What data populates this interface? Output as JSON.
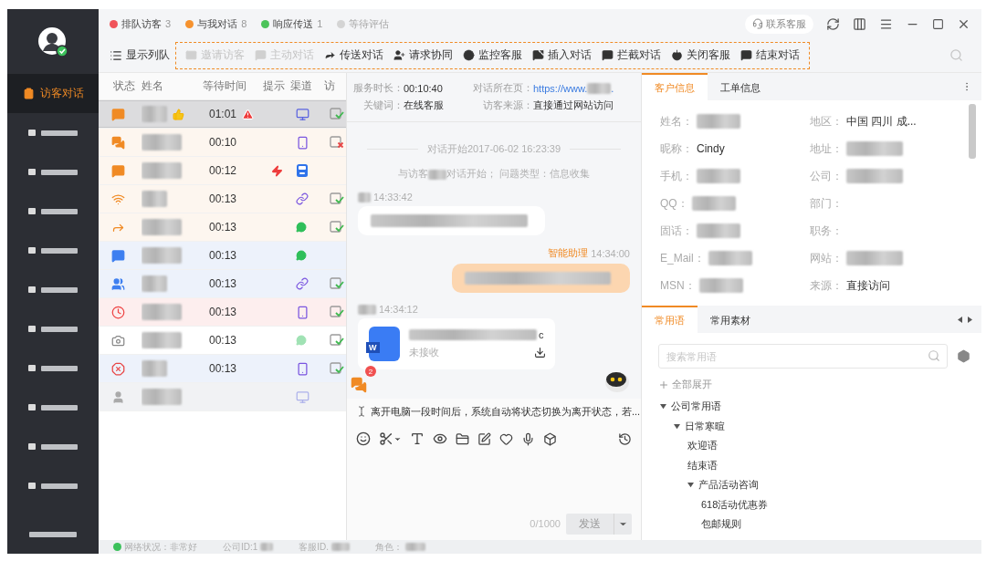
{
  "sidebar": {
    "items": [
      {
        "kind": "nav",
        "label": "访客对话",
        "selected": true
      },
      {
        "kind": "nav",
        "redacted": true,
        "selected": false
      },
      {
        "kind": "nav",
        "redacted": true,
        "selected": false
      },
      {
        "kind": "nav",
        "redacted": true,
        "selected": false
      },
      {
        "kind": "nav",
        "redacted": true,
        "selected": false
      },
      {
        "kind": "nav",
        "redacted": true,
        "selected": false
      },
      {
        "kind": "nav",
        "redacted": true,
        "selected": false
      },
      {
        "kind": "nav",
        "redacted": true,
        "selected": false
      },
      {
        "kind": "nav",
        "redacted": true,
        "selected": false
      },
      {
        "kind": "nav",
        "redacted": true,
        "selected": false
      },
      {
        "kind": "nav",
        "redacted": true,
        "selected": false
      },
      {
        "kind": "footer",
        "redacted": true,
        "selected": false
      }
    ]
  },
  "queue_tabs": [
    {
      "label": "排队访客",
      "count": "3",
      "color": "#f0535a",
      "disabled": false
    },
    {
      "label": "与我对话",
      "count": "8",
      "color": "#f6922e",
      "disabled": false
    },
    {
      "label": "响应传送",
      "count": "1",
      "color": "#4cc35a",
      "disabled": false
    },
    {
      "label": "等待评估",
      "color": "#d4d4d4",
      "disabled": true
    }
  ],
  "contact_button": "联系客服",
  "toolbar": {
    "queue_toggle": "显示列队",
    "actions": [
      {
        "label": "邀请访客",
        "disabled": true
      },
      {
        "label": "主动对话",
        "disabled": true
      },
      {
        "label": "传送对话",
        "disabled": false
      },
      {
        "label": "请求协同",
        "disabled": false
      },
      {
        "label": "监控客服",
        "disabled": false
      },
      {
        "label": "插入对话",
        "disabled": false
      },
      {
        "label": "拦截对话",
        "disabled": false
      },
      {
        "label": "关闭客服",
        "disabled": false
      },
      {
        "label": "结束对话",
        "disabled": false
      }
    ]
  },
  "visitor_table": {
    "columns": [
      "状态",
      "姓名",
      "等待时间",
      "提示",
      "渠道",
      "访"
    ],
    "rows": [
      {
        "color": "#dcdcde",
        "selected": true,
        "status": {
          "kind": "chat"
        },
        "liked": true,
        "wait": "01:01",
        "alert": true,
        "channel": {
          "kind": "pc",
          "offline": false
        },
        "visit": {
          "kind": "check"
        }
      },
      {
        "color": "#fdf6ef",
        "selected": false,
        "status": {
          "kind": "chats"
        },
        "liked": false,
        "wait": "00:10",
        "alert": false,
        "channel": {
          "kind": "phone",
          "offline": false
        },
        "visit": {
          "kind": "cross"
        }
      },
      {
        "color": "#fdf6ef",
        "selected": false,
        "status": {
          "kind": "chat-plus"
        },
        "liked": false,
        "wait": "00:12",
        "alert": false,
        "hint": {
          "kind": "flash"
        },
        "channel": {
          "kind": "mini-app",
          "offline": false
        }
      },
      {
        "color": "#fdf6ef",
        "selected": false,
        "status": {
          "kind": "wifi"
        },
        "liked": false,
        "wait": "00:13",
        "alert": false,
        "channel": {
          "kind": "link",
          "offline": false
        },
        "visit": {
          "kind": "check"
        }
      },
      {
        "color": "#fdf6ef",
        "selected": false,
        "status": {
          "kind": "forward"
        },
        "liked": false,
        "wait": "00:13",
        "alert": false,
        "channel": {
          "kind": "wechat",
          "offline": false
        },
        "visit": {
          "kind": "check"
        }
      },
      {
        "color": "#edf2fb",
        "selected": false,
        "status": {
          "kind": "chat-user"
        },
        "liked": false,
        "wait": "00:13",
        "alert": false,
        "channel": {
          "kind": "wechat",
          "offline": false
        }
      },
      {
        "color": "#edf2fb",
        "selected": false,
        "status": {
          "kind": "users"
        },
        "liked": false,
        "wait": "00:13",
        "alert": false,
        "channel": {
          "kind": "link",
          "offline": false
        },
        "visit": {
          "kind": "check"
        }
      },
      {
        "color": "#fdeeee",
        "selected": false,
        "status": {
          "kind": "clock"
        },
        "liked": false,
        "wait": "00:13",
        "alert": false,
        "channel": {
          "kind": "phone",
          "offline": false
        },
        "visit": {
          "kind": "check"
        }
      },
      {
        "color": "#ffffff",
        "selected": false,
        "status": {
          "kind": "camera"
        },
        "liked": false,
        "wait": "00:13",
        "alert": false,
        "channel": {
          "kind": "wechat",
          "offline": true
        },
        "visit": {
          "kind": "check"
        }
      },
      {
        "color": "#edf2fb",
        "selected": false,
        "status": {
          "kind": "blocked"
        },
        "liked": false,
        "wait": "00:13",
        "alert": false,
        "channel": {
          "kind": "phone",
          "offline": false
        },
        "visit": {
          "kind": "check"
        }
      },
      {
        "color": "#f1f2f4",
        "selected": false,
        "status": {
          "kind": "user"
        },
        "liked": false,
        "alert": false,
        "channel": {
          "kind": "pc",
          "offline": true
        }
      }
    ]
  },
  "chat": {
    "info": [
      {
        "label": "服务时长：",
        "value": "00:10:40"
      },
      {
        "label": "对话所在页：",
        "value": "https://www.",
        "link": true,
        "redacted": true,
        "tail": "."
      },
      {
        "label": "关键词：",
        "value": "在线客服"
      },
      {
        "label": "访客来源：",
        "value": "直接通过网站访问"
      }
    ],
    "start_divider": "对话开始2017-06-02 16:23:39",
    "system_message": {
      "before": "与访客",
      "after": "对话开始； 问题类型：信息收集"
    },
    "messages": [
      {
        "kind": "visitor",
        "time": "14:33:42"
      },
      {
        "kind": "agent",
        "sender": "智能助理",
        "time": "14:34:00"
      },
      {
        "kind": "file",
        "time": "14:34:12",
        "file": {
          "type_label": "W",
          "name_tail": "c",
          "status": "未接收"
        }
      }
    ],
    "unread_badge": "2",
    "composer": {
      "tip": "离开电脑一段时间后，系统自动将状态切换为离开状态，若...",
      "counter": "0/1000",
      "send": "发送"
    }
  },
  "customer_panel": {
    "tabs": [
      {
        "label": "客户信息",
        "selected": true
      },
      {
        "label": "工单信息",
        "selected": false
      }
    ],
    "fields": [
      {
        "label": "姓名：",
        "redacted": true
      },
      {
        "label": "地区：",
        "value": "中国 四川 成..."
      },
      {
        "label": "昵称：",
        "value": "Cindy"
      },
      {
        "label": "地址：",
        "redacted": true
      },
      {
        "label": "手机：",
        "redacted": true
      },
      {
        "label": "公司：",
        "redacted": true
      },
      {
        "label": "QQ：",
        "redacted": true
      },
      {
        "label": "部门："
      },
      {
        "label": "固话：",
        "redacted": true
      },
      {
        "label": "职务："
      },
      {
        "label": "E_Mail：",
        "redacted": true
      },
      {
        "label": "网站：",
        "redacted": true
      },
      {
        "label": "MSN：",
        "redacted": true
      },
      {
        "label": "来源：",
        "value": "直接访问"
      }
    ]
  },
  "snippets": {
    "tabs": [
      {
        "label": "常用语",
        "selected": true
      },
      {
        "label": "常用素材",
        "selected": false
      }
    ],
    "search": {
      "placeholder": "搜索常用语"
    },
    "expand_all": "全部展开",
    "tree": [
      {
        "label": "公司常用语",
        "expanded": true,
        "children": [
          {
            "label": "日常寒暄",
            "expanded": true,
            "children": [
              {
                "label": "欢迎语"
              },
              {
                "label": "结束语"
              },
              {
                "label": "产品活动咨询",
                "expanded": true,
                "children": [
                  {
                    "label": "618活动优惠券"
                  },
                  {
                    "label": "包邮规则"
                  }
                ]
              }
            ]
          }
        ]
      }
    ]
  },
  "status_bar": {
    "network": "网络状况：非常好",
    "network_ok": true,
    "company": "公司ID:1",
    "agent": "客服ID.",
    "role": "角色："
  }
}
